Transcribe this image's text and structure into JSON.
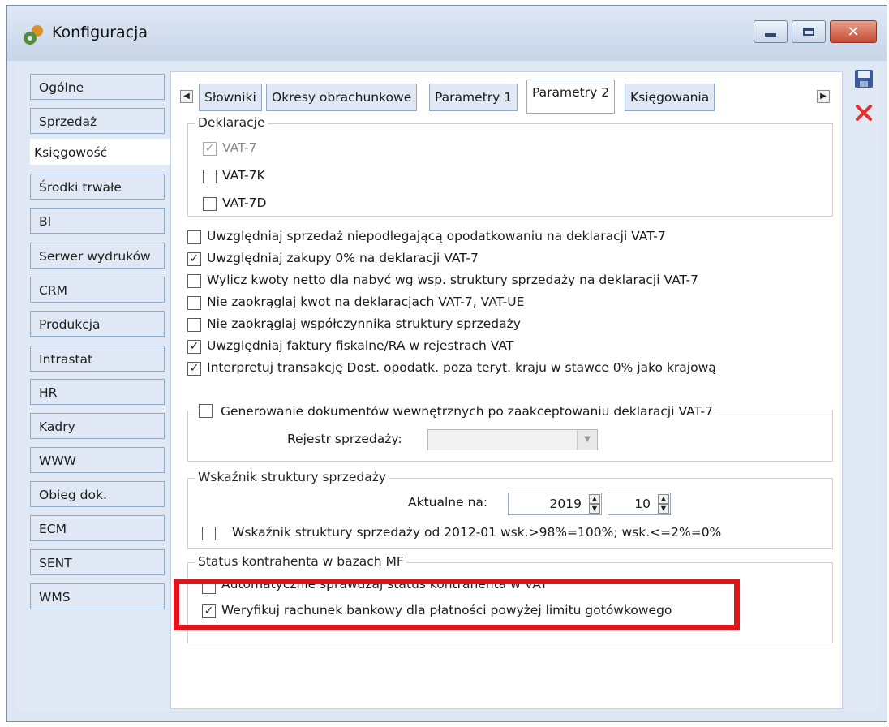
{
  "window": {
    "title": "Konfiguracja"
  },
  "nav": [
    "Ogólne",
    "Sprzedaż",
    "Księgowość",
    "Środki trwałe",
    "BI",
    "Serwer wydruków",
    "CRM",
    "Produkcja",
    "Intrastat",
    "HR",
    "Kadry",
    "WWW",
    "Obieg dok.",
    "ECM",
    "SENT",
    "WMS"
  ],
  "tabs": [
    "Słowniki",
    "Okresy obrachunkowe",
    "Parametry 1",
    "Parametry 2",
    "Księgowania"
  ],
  "deklaracje": {
    "title": "Deklaracje",
    "items": [
      {
        "label": "VAT-7",
        "checked": true,
        "disabled": true
      },
      {
        "label": "VAT-7K",
        "checked": false
      },
      {
        "label": "VAT-7D",
        "checked": false
      }
    ]
  },
  "options": [
    {
      "label": "Uwzględniaj sprzedaż niepodlegającą opodatkowaniu na deklaracji VAT-7",
      "checked": false
    },
    {
      "label": "Uwzględniaj zakupy 0% na deklaracji VAT-7",
      "checked": true
    },
    {
      "label": "Wylicz kwoty netto dla nabyć wg wsp. struktury sprzedaży na deklaracji VAT-7",
      "checked": false
    },
    {
      "label": "Nie zaokrąglaj kwot na deklaracjach VAT-7, VAT-UE",
      "checked": false
    },
    {
      "label": "Nie zaokrąglaj współczynnika struktury sprzedaży",
      "checked": false
    },
    {
      "label": "Uwzględniaj faktury fiskalne/RA w rejestrach VAT",
      "checked": true
    },
    {
      "label": "Interpretuj transakcję Dost. opodatk. poza teryt. kraju w stawce 0% jako krajową",
      "checked": true
    }
  ],
  "generowanie": {
    "label": "Generowanie dokumentów wewnętrznych po zaakceptowaniu deklaracji VAT-7",
    "checked": false,
    "rejestr_label": "Rejestr sprzedaży:",
    "rejestr_value": ""
  },
  "wskaznik": {
    "title": "Wskaźnik struktury sprzedaży",
    "aktualne_label": "Aktualne na:",
    "year": "2019",
    "month": "10",
    "option_label": "Wskaźnik struktury sprzedaży od 2012-01 wsk.>98%=100%; wsk.<=2%=0%",
    "option_checked": false
  },
  "status": {
    "title": "Status kontrahenta w bazach MF",
    "auto_label": "Automatycznie sprawdzaj status kontrahenta w VAT",
    "auto_checked": false,
    "verify_label": "Weryfikuj rachunek bankowy dla płatności powyżej limitu gotówkowego",
    "verify_checked": true
  },
  "glyphs": {
    "check": "✓",
    "left": "◀",
    "right": "▶",
    "down": "▼",
    "up": "▲",
    "close": "✕"
  },
  "colors": {
    "highlight": "#e1141c",
    "save": "#3a5a9c",
    "cancel": "#e0322a"
  },
  "icons": {
    "app": "gear-icon",
    "save": "floppy-disk-icon",
    "cancel": "cancel-icon"
  }
}
